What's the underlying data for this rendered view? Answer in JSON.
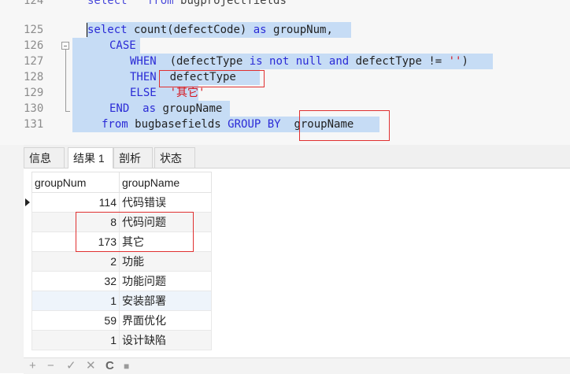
{
  "editor": {
    "line_numbers": [
      "124",
      "125",
      "126",
      "127",
      "128",
      "129",
      "130",
      "131"
    ],
    "line124": {
      "a": "select",
      "b": "from",
      "c": "bugprojectfields"
    },
    "line125": {
      "kw1": "select",
      "t1": " count(defectCode) ",
      "kw2": "as",
      "t2": " groupNum,"
    },
    "line126": {
      "kw": "CASE"
    },
    "line127": {
      "kw1": "WHEN",
      "t1": "  (defectType ",
      "kw2": "is not null",
      "t2": " ",
      "kw3": "and",
      "t3": " defectType != ",
      "str": "''",
      "t4": ")"
    },
    "line128": {
      "kw": "THEN",
      "t1": "  defectType"
    },
    "line129": {
      "kw": "ELSE",
      "str": "'其它'"
    },
    "line130": {
      "kw1": "END",
      "kw2": "as",
      "t1": " groupName"
    },
    "line131": {
      "kw1": "from",
      "t1": " bugbasefields ",
      "kw2": "GROUP BY",
      "t2": "groupName"
    }
  },
  "tabs": [
    {
      "label": "信息"
    },
    {
      "label": "结果 1"
    },
    {
      "label": "剖析"
    },
    {
      "label": "状态"
    }
  ],
  "grid": {
    "columns": [
      "groupNum",
      "groupName"
    ],
    "rows": [
      {
        "num": "114",
        "name": "代码错误"
      },
      {
        "num": "8",
        "name": "代码问题"
      },
      {
        "num": "173",
        "name": "其它"
      },
      {
        "num": "2",
        "name": "功能"
      },
      {
        "num": "32",
        "name": "功能问题"
      },
      {
        "num": "1",
        "name": "安装部署"
      },
      {
        "num": "59",
        "name": "界面优化"
      },
      {
        "num": "1",
        "name": "设计缺陷"
      }
    ]
  },
  "toolbar": {
    "add": "+",
    "remove": "−",
    "apply": "✓",
    "cancel": "✕",
    "refresh": "C",
    "stop": "■"
  }
}
